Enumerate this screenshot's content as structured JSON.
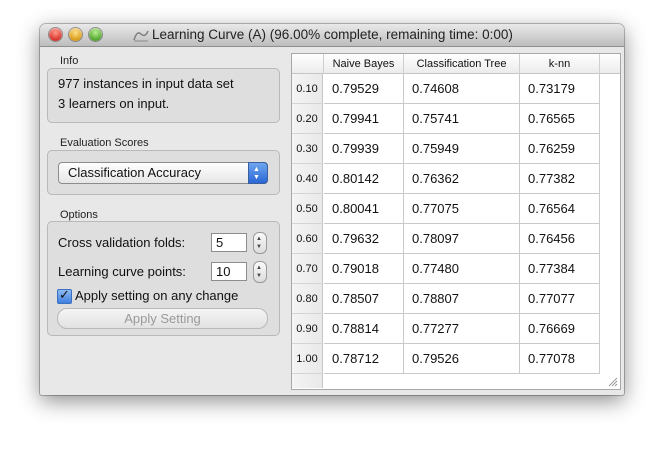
{
  "window": {
    "title": "Learning Curve (A) (96.00% complete, remaining time: 0:00)"
  },
  "info": {
    "label": "Info",
    "line1": "977 instances in input data set",
    "line2": "3 learners on input."
  },
  "evaluation": {
    "label": "Evaluation Scores",
    "selected": "Classification Accuracy"
  },
  "options": {
    "label": "Options",
    "folds_label": "Cross validation folds:",
    "folds_value": "5",
    "points_label": "Learning curve points:",
    "points_value": "10",
    "apply_checkbox_label": "Apply setting on any change",
    "apply_checked": true,
    "apply_button": "Apply Setting"
  },
  "table": {
    "columns": [
      "Naive Bayes",
      "Classification Tree",
      "k-nn"
    ],
    "rows": [
      {
        "label": "0.10",
        "values": [
          "0.79529",
          "0.74608",
          "0.73179"
        ]
      },
      {
        "label": "0.20",
        "values": [
          "0.79941",
          "0.75741",
          "0.76565"
        ]
      },
      {
        "label": "0.30",
        "values": [
          "0.79939",
          "0.75949",
          "0.76259"
        ]
      },
      {
        "label": "0.40",
        "values": [
          "0.80142",
          "0.76362",
          "0.77382"
        ]
      },
      {
        "label": "0.50",
        "values": [
          "0.80041",
          "0.77075",
          "0.76564"
        ]
      },
      {
        "label": "0.60",
        "values": [
          "0.79632",
          "0.78097",
          "0.76456"
        ]
      },
      {
        "label": "0.70",
        "values": [
          "0.79018",
          "0.77480",
          "0.77384"
        ]
      },
      {
        "label": "0.80",
        "values": [
          "0.78507",
          "0.78807",
          "0.77077"
        ]
      },
      {
        "label": "0.90",
        "values": [
          "0.78814",
          "0.77277",
          "0.76669"
        ]
      },
      {
        "label": "1.00",
        "values": [
          "0.78712",
          "0.79526",
          "0.77078"
        ]
      }
    ]
  }
}
